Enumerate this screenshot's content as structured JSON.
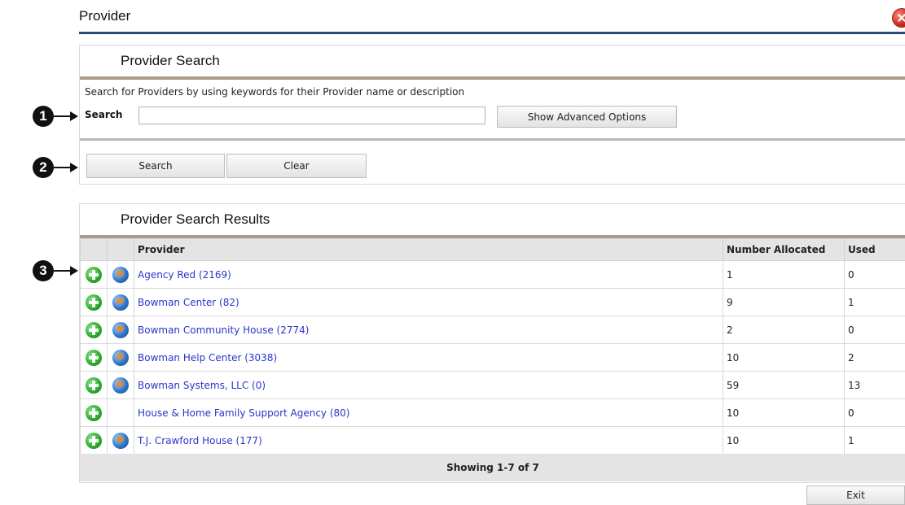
{
  "window": {
    "title": "Provider"
  },
  "search_panel": {
    "heading": "Provider Search",
    "help_text": "Search for Providers by using keywords for their Provider name or description",
    "search_label": "Search",
    "search_value": "",
    "search_placeholder": "",
    "advanced_button": "Show Advanced Options",
    "search_button": "Search",
    "clear_button": "Clear"
  },
  "results_panel": {
    "heading": "Provider Search Results",
    "columns": [
      "Provider",
      "Number Allocated",
      "Used"
    ],
    "rows": [
      {
        "provider": "Agency Red (2169)",
        "allocated": "1",
        "used": "0",
        "has_globe": true
      },
      {
        "provider": "Bowman Center (82)",
        "allocated": "9",
        "used": "1",
        "has_globe": true
      },
      {
        "provider": "Bowman Community House (2774)",
        "allocated": "2",
        "used": "0",
        "has_globe": true
      },
      {
        "provider": "Bowman Help Center (3038)",
        "allocated": "10",
        "used": "2",
        "has_globe": true
      },
      {
        "provider": "Bowman Systems, LLC (0)",
        "allocated": "59",
        "used": "13",
        "has_globe": true
      },
      {
        "provider": "House & Home Family Support Agency (80)",
        "allocated": "10",
        "used": "0",
        "has_globe": false
      },
      {
        "provider": "T.J. Crawford House (177)",
        "allocated": "10",
        "used": "1",
        "has_globe": true
      }
    ],
    "footer": "Showing 1-7 of 7"
  },
  "exit_button": "Exit",
  "callouts": [
    "1",
    "2",
    "3"
  ],
  "colors": {
    "title_bar": "#2a4a72",
    "link": "#2a36c9",
    "panel_rule": "#a89c86"
  }
}
